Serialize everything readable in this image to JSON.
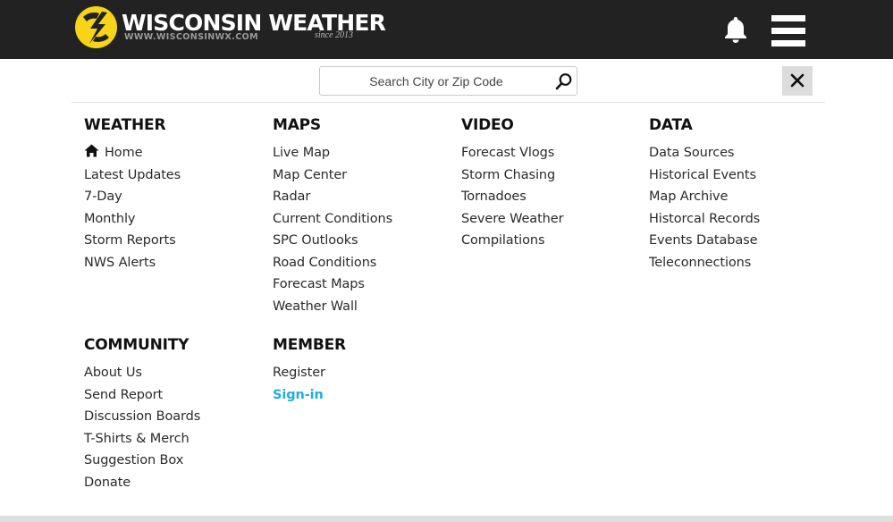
{
  "header": {
    "logo_title": "WISCONSIN WEATHER",
    "logo_url": "WWW.WISCONSINWX.COM",
    "logo_since": "since 2013",
    "bell_icon": "bell-icon",
    "menu_icon": "hamburger-menu-icon"
  },
  "search": {
    "placeholder": "Search City or Zip Code",
    "icon": "search-icon"
  },
  "close_icon": "close-icon",
  "colors": {
    "header_bg": "#222222",
    "logo_yellow": "#f7d417",
    "link_accent": "#1eaee0",
    "close_bg": "#dcdcdc"
  },
  "menu": {
    "weather": {
      "title": "WEATHER",
      "items": [
        "Home",
        "Latest Updates",
        "7-Day",
        "Monthly",
        "Storm Reports",
        "NWS Alerts"
      ]
    },
    "maps": {
      "title": "MAPS",
      "items": [
        "Live Map",
        "Map Center",
        "Radar",
        "Current Conditions",
        "SPC Outlooks",
        "Road Conditions",
        "Forecast Maps",
        "Weather Wall"
      ]
    },
    "video": {
      "title": "VIDEO",
      "items": [
        "Forecast Vlogs",
        "Storm Chasing",
        "Tornadoes",
        "Severe Weather",
        "Compilations"
      ]
    },
    "data": {
      "title": "DATA",
      "items": [
        "Data Sources",
        "Historical Events",
        "Map Archive",
        "Historcal Records",
        "Events Database",
        "Teleconnections"
      ]
    },
    "community": {
      "title": "COMMUNITY",
      "items": [
        "About Us",
        "Send Report",
        "Discussion Boards",
        "T-Shirts & Merch",
        "Suggestion Box",
        "Donate"
      ]
    },
    "member": {
      "title": "MEMBER",
      "items": [
        "Register",
        "Sign-in"
      ]
    }
  }
}
